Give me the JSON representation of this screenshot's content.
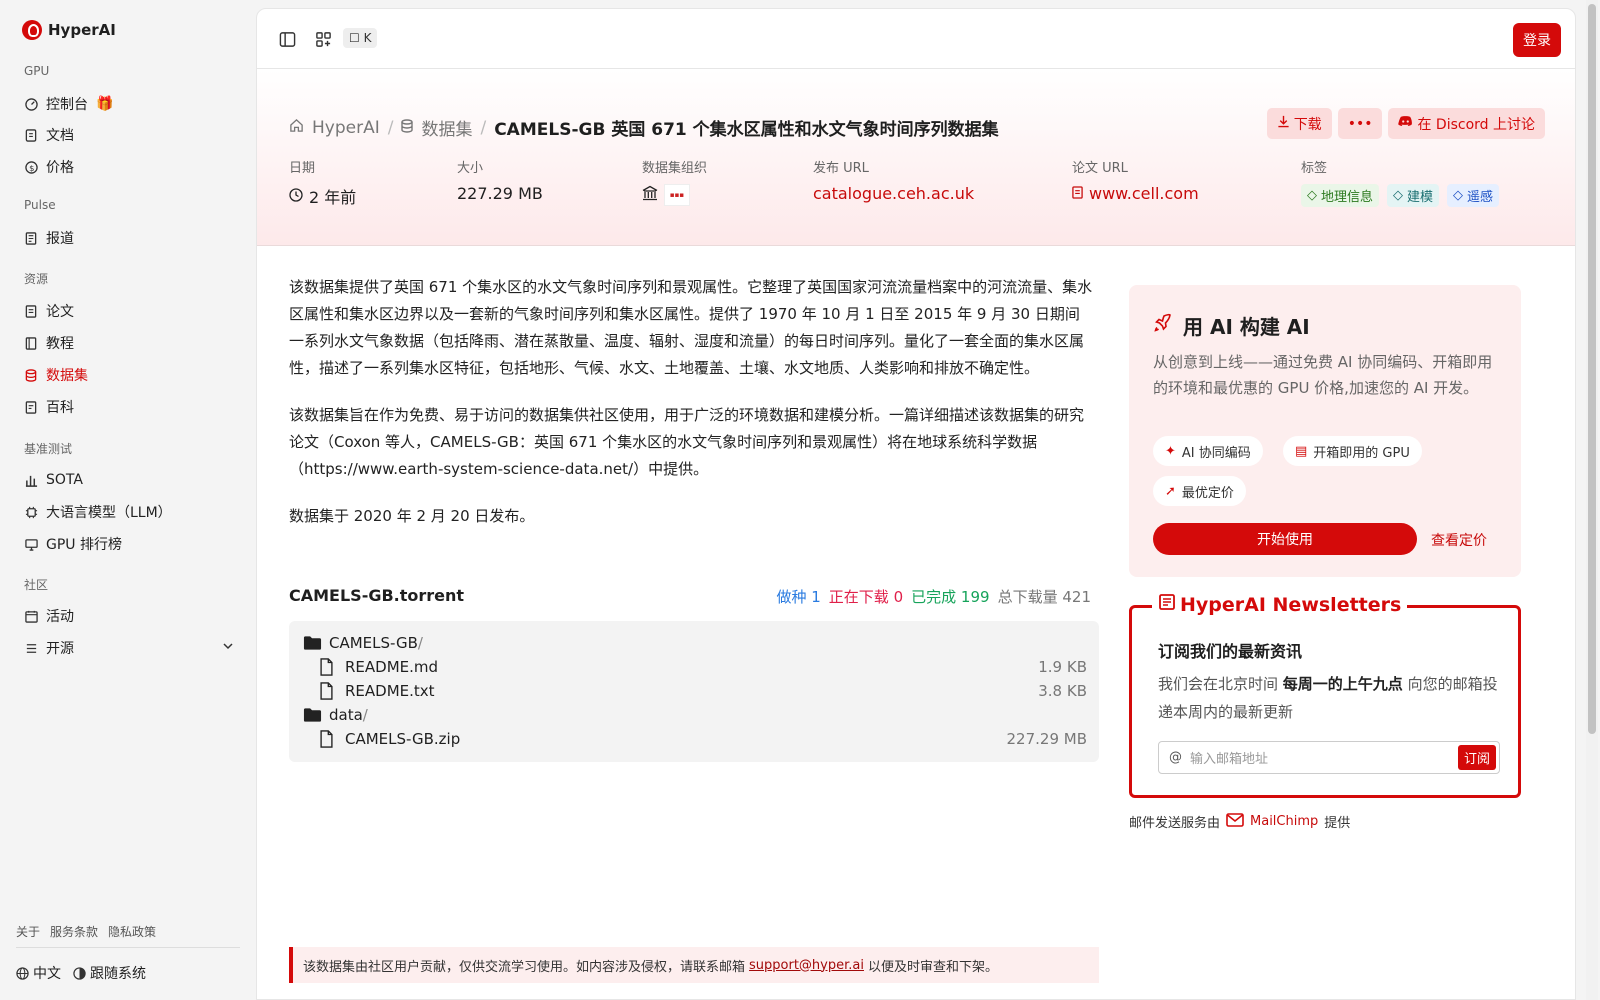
{
  "sidebar": {
    "brand": "HyperAI",
    "sections": [
      {
        "label": "GPU",
        "items": [
          {
            "label": "控制台",
            "icon": "dashboard-icon"
          },
          {
            "label": "文档",
            "icon": "doc-icon"
          },
          {
            "label": "价格",
            "icon": "price-icon"
          }
        ]
      },
      {
        "label": "Pulse",
        "items": [
          {
            "label": "报道",
            "icon": "news-icon"
          }
        ]
      },
      {
        "label": "资源",
        "items": [
          {
            "label": "论文",
            "icon": "paper-icon"
          },
          {
            "label": "教程",
            "icon": "tutorial-icon"
          },
          {
            "label": "数据集",
            "icon": "database-icon",
            "active": true
          },
          {
            "label": "百科",
            "icon": "wiki-icon"
          }
        ]
      },
      {
        "label": "基准测试",
        "items": [
          {
            "label": "SOTA",
            "icon": "chart-icon"
          },
          {
            "label": "大语言模型（LLM）",
            "icon": "chip-icon"
          },
          {
            "label": "GPU 排行榜",
            "icon": "monitor-icon"
          }
        ]
      },
      {
        "label": "社区",
        "items": [
          {
            "label": "活动",
            "icon": "calendar-icon"
          },
          {
            "label": "开源",
            "icon": "list-icon"
          }
        ]
      }
    ],
    "footer_links": [
      "关于",
      "服务条款",
      "隐私政策"
    ],
    "language": "中文",
    "tracking": "跟随系统"
  },
  "topbar": {
    "shortcut": "K",
    "login": "登录"
  },
  "breadcrumb": {
    "home": "HyperAI",
    "datasets": "数据集",
    "current": "CAMELS-GB 英国 671 个集水区属性和水文气象时间序列数据集"
  },
  "actions": {
    "download": "下载",
    "discord": "在 Discord 上讨论"
  },
  "meta": {
    "date_label": "日期",
    "date_value": "2 年前",
    "size_label": "大小",
    "size_value": "227.29 MB",
    "org_label": "数据集组织",
    "publish_label": "发布 URL",
    "publish_value": "catalogue.ceh.ac.uk",
    "paper_label": "论文 URL",
    "paper_value": "www.cell.com",
    "tags_label": "标签",
    "tags": [
      "地理信息",
      "建模",
      "遥感"
    ]
  },
  "description": [
    "该数据集提供了英国 671 个集水区的水文气象时间序列和景观属性。它整理了英国国家河流流量档案中的河流流量、集水区属性和集水区边界以及一套新的气象时间序列和集水区属性。提供了 1970 年 10 月 1 日至 2015 年 9 月 30 日期间一系列水文气象数据（包括降雨、潜在蒸散量、温度、辐射、湿度和流量）的每日时间序列。量化了一套全面的集水区属性，描述了一系列集水区特征，包括地形、气候、水文、土地覆盖、土壤、水文地质、人类影响和排放不确定性。",
    "该数据集旨在作为免费、易于访问的数据集供社区使用，用于广泛的环境数据和建模分析。一篇详细描述该数据集的研究论文（Coxon 等人，CAMELS-GB：英国 671 个集水区的水文气象时间序列和景观属性）将在地球系统科学数据（https://www.earth-system-science-data.net/）中提供。",
    "数据集于 2020 年 2 月 20 日发布。"
  ],
  "torrent": {
    "title": "CAMELS-GB.torrent",
    "seeding_label": "做种",
    "seeding": "1",
    "downloading_label": "正在下载",
    "downloading": "0",
    "completed_label": "已完成",
    "completed": "199",
    "total_label": "总下载量",
    "total": "421",
    "files": [
      {
        "name": "CAMELS-GB",
        "slash": "/",
        "type": "folder",
        "size": ""
      },
      {
        "name": "README.md",
        "type": "file",
        "size": "1.9 KB"
      },
      {
        "name": "README.txt",
        "type": "file",
        "size": "3.8 KB"
      },
      {
        "name": "data",
        "slash": "/",
        "type": "folder",
        "size": ""
      },
      {
        "name": "CAMELS-GB.zip",
        "type": "file",
        "size": "227.29 MB"
      }
    ]
  },
  "ai_card": {
    "title": "用 AI 构建 AI",
    "desc": "从创意到上线——通过免费 AI 协同编码、开箱即用的环境和最优惠的 GPU 价格,加速您的 AI 开发。",
    "chips": [
      "AI 协同编码",
      "开箱即用的 GPU",
      "最优定价"
    ],
    "start": "开始使用",
    "pricing": "查看定价"
  },
  "newsletter": {
    "title": "HyperAI Newsletters",
    "heading": "订阅我们的最新资讯",
    "p1": "我们会在北京时间 ",
    "p_bold": "每周一的上午九点",
    "p2": " 向您的邮箱投递本周内的最新更新",
    "placeholder": "输入邮箱地址",
    "subscribe": "订阅",
    "mail_prefix": "邮件发送服务由",
    "mail_brand": "MailChimp",
    "mail_suffix": "提供"
  },
  "notice": {
    "prefix": "该数据集由社区用户贡献，仅供交流学习使用。如内容涉及侵权，请联系邮箱",
    "email": "support@hyper.ai",
    "suffix": "以便及时审查和下架。"
  }
}
